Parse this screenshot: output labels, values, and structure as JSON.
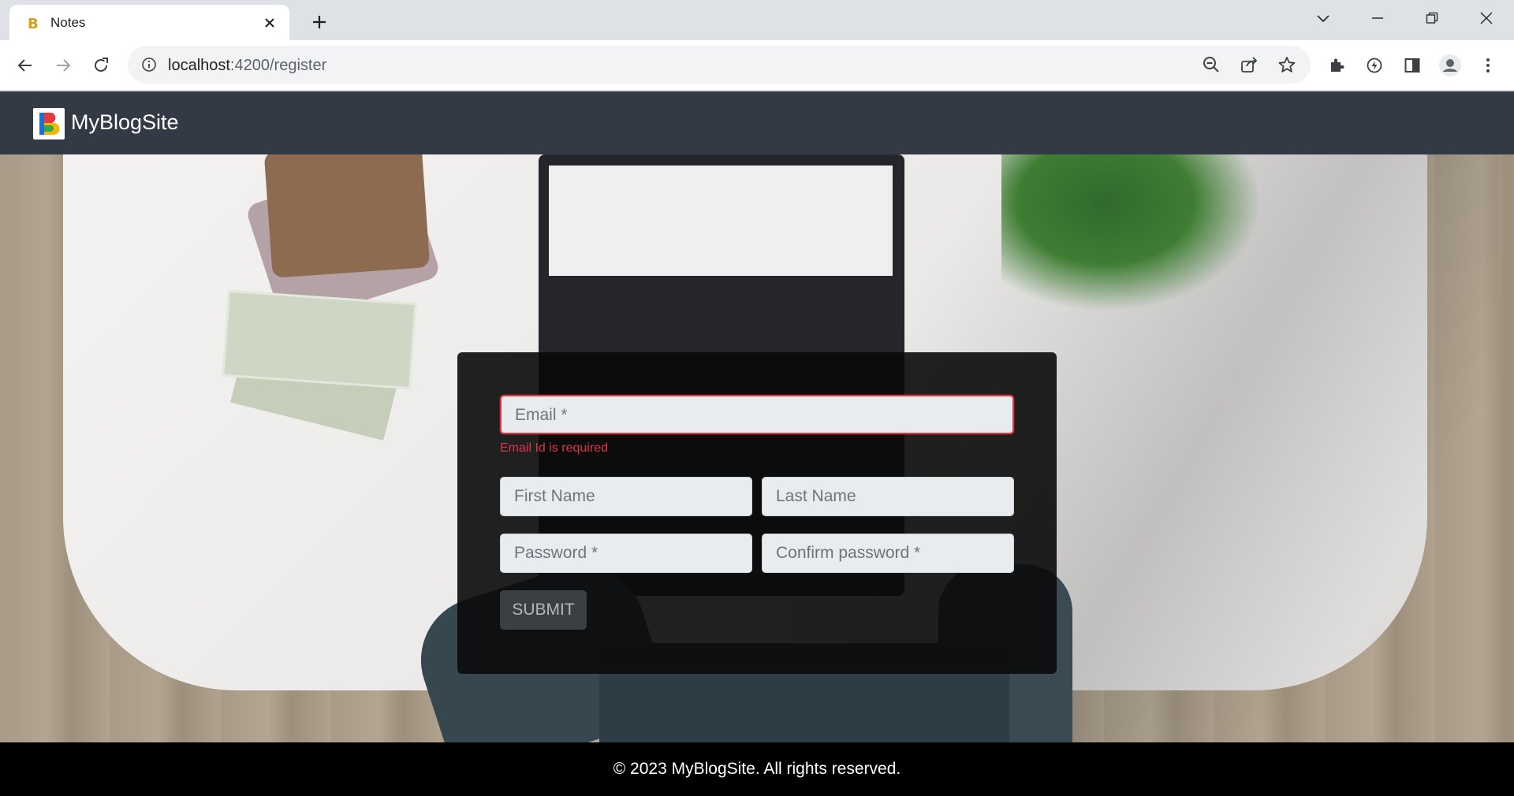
{
  "browser": {
    "tab_title": "Notes",
    "url_host": "localhost",
    "url_path": ":4200/register"
  },
  "navbar": {
    "brand": "MyBlogSite",
    "logo_letter": "B"
  },
  "form": {
    "email_placeholder": "Email *",
    "email_error": "Email Id is required",
    "first_name_placeholder": "First Name",
    "last_name_placeholder": "Last Name",
    "password_placeholder": "Password *",
    "confirm_password_placeholder": "Confirm password *",
    "submit_label": "SUBMIT"
  },
  "footer": {
    "text": "© 2023 MyBlogSite. All rights reserved."
  },
  "colors": {
    "navbar_bg": "#343a45",
    "error": "#dc3545",
    "footer_bg": "#000000"
  },
  "icons": [
    "close-icon",
    "plus-icon",
    "chevron-down-icon",
    "minimize-icon",
    "restore-icon",
    "back-icon",
    "forward-icon",
    "reload-icon",
    "info-icon",
    "zoom-out-icon",
    "share-icon",
    "star-icon",
    "extensions-icon",
    "performance-icon",
    "sidepanel-icon",
    "profile-icon",
    "more-icon"
  ]
}
